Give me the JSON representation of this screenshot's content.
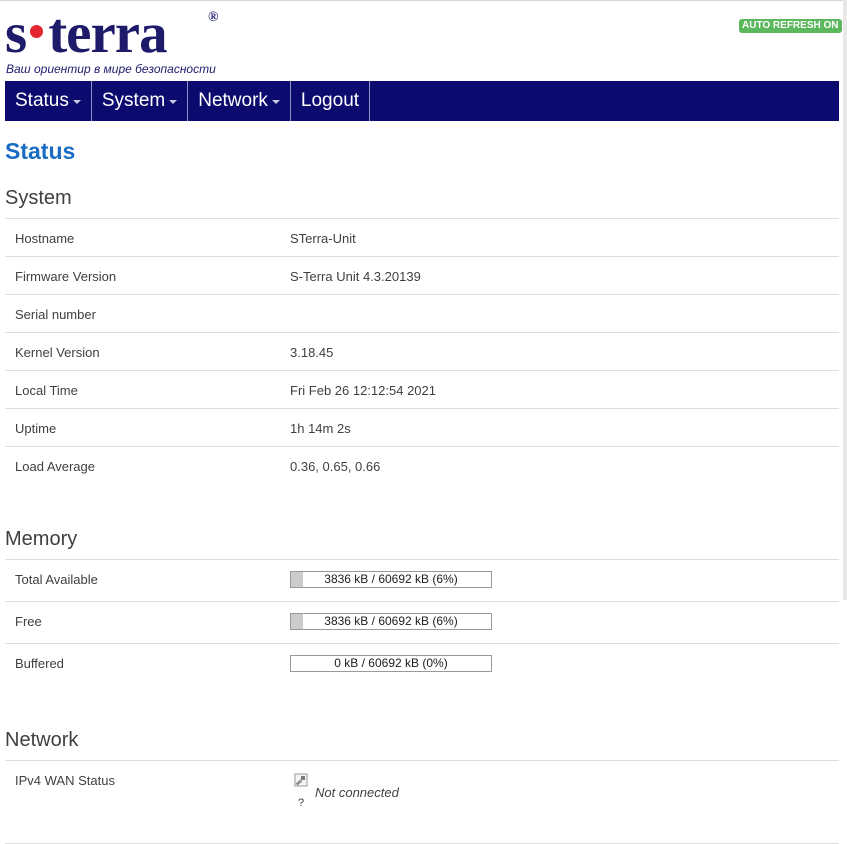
{
  "header": {
    "logo_word_left": "s",
    "logo_word_right": "terra",
    "logo_registered": "®",
    "logo_tagline": "Ваш ориентир в мире безопасности",
    "auto_refresh": "AUTO REFRESH ON"
  },
  "nav": {
    "items": [
      {
        "label": "Status",
        "has_caret": true
      },
      {
        "label": "System",
        "has_caret": true
      },
      {
        "label": "Network",
        "has_caret": true
      },
      {
        "label": "Logout",
        "has_caret": false
      }
    ]
  },
  "page_title": "Status",
  "system": {
    "title": "System",
    "rows": [
      {
        "label": "Hostname",
        "value": "STerra-Unit"
      },
      {
        "label": "Firmware Version",
        "value": "S-Terra Unit 4.3.20139"
      },
      {
        "label": "Serial number",
        "value": ""
      },
      {
        "label": "Kernel Version",
        "value": "3.18.45"
      },
      {
        "label": "Local Time",
        "value": "Fri Feb 26 12:12:54 2021"
      },
      {
        "label": "Uptime",
        "value": "1h 14m 2s"
      },
      {
        "label": "Load Average",
        "value": "0.36, 0.65, 0.66"
      }
    ]
  },
  "memory": {
    "title": "Memory",
    "rows": [
      {
        "label": "Total Available",
        "text": "3836 kB / 60692 kB (6%)",
        "percent": 6
      },
      {
        "label": "Free",
        "text": "3836 kB / 60692 kB (6%)",
        "percent": 6
      },
      {
        "label": "Buffered",
        "text": "0 kB / 60692 kB (0%)",
        "percent": 0
      }
    ]
  },
  "network": {
    "title": "Network",
    "wan_label": "IPv4 WAN Status",
    "wan_icon_caption": "?",
    "wan_status": "Not connected"
  },
  "colors": {
    "nav_bg": "#0b0b6f",
    "title_blue": "#1a6bc4",
    "badge_green": "#5cb85c",
    "logo_navy": "#1e1b6b",
    "logo_red": "#e3262f"
  }
}
